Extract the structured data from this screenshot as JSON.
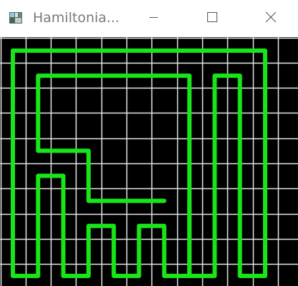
{
  "window": {
    "title": "Hamiltonia...",
    "title_color": "#7a7a7a",
    "minimize_icon": "minimize-icon",
    "maximize_icon": "maximize-icon",
    "close_icon": "close-icon",
    "app_icon": "app-grid-icon"
  },
  "board": {
    "columns": 11,
    "rows": 9,
    "background_color": "#000000",
    "grid_color": "#e6e6e6",
    "path_color": "#19e619",
    "path": [
      [
        0,
        0
      ],
      [
        10,
        0
      ],
      [
        10,
        9
      ],
      [
        9,
        9
      ],
      [
        9,
        1
      ],
      [
        8,
        1
      ],
      [
        8,
        9
      ],
      [
        7,
        9
      ],
      [
        7,
        1
      ],
      [
        1,
        1
      ],
      [
        1,
        4
      ],
      [
        3,
        4
      ],
      [
        3,
        6
      ],
      [
        6,
        6
      ]
    ],
    "path_tail": [
      [
        7,
        6
      ],
      [
        7,
        9
      ],
      [
        6,
        9
      ],
      [
        6,
        7
      ],
      [
        5,
        7
      ],
      [
        5,
        9
      ],
      [
        4,
        9
      ],
      [
        4,
        7
      ],
      [
        3,
        7
      ],
      [
        3,
        9
      ],
      [
        2,
        9
      ],
      [
        2,
        5
      ],
      [
        1,
        5
      ],
      [
        1,
        9
      ],
      [
        0,
        9
      ],
      [
        0,
        0
      ]
    ]
  }
}
